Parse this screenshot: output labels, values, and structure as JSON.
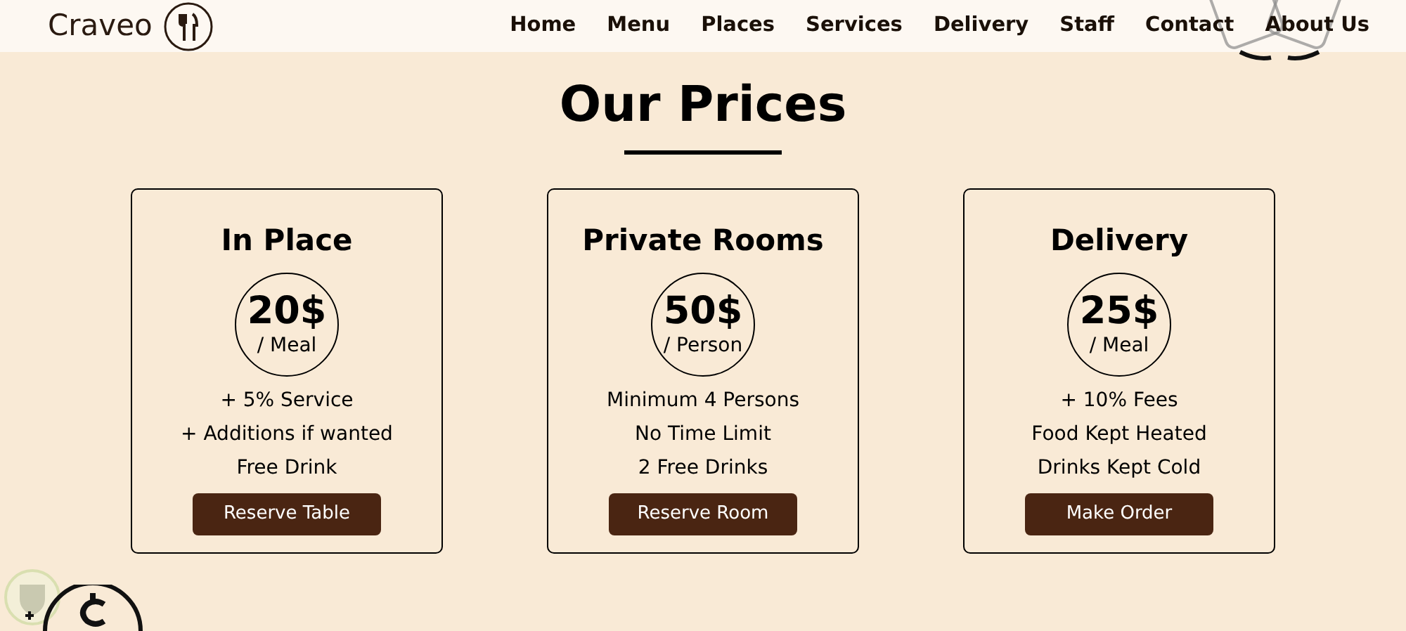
{
  "brand": "Craveo",
  "nav": [
    "Home",
    "Menu",
    "Places",
    "Services",
    "Delivery",
    "Staff",
    "Contact",
    "About Us"
  ],
  "title": "Our Prices",
  "plans": [
    {
      "name": "In Place",
      "price": "20$",
      "unit": "/ Meal",
      "features": [
        "+ 5% Service",
        "+ Additions if wanted",
        "Free Drink"
      ],
      "button": "Reserve Table"
    },
    {
      "name": "Private Rooms",
      "price": "50$",
      "unit": "/ Person",
      "features": [
        "Minimum 4 Persons",
        "No Time Limit",
        "2 Free Drinks"
      ],
      "button": "Reserve Room"
    },
    {
      "name": "Delivery",
      "price": "25$",
      "unit": "/ Meal",
      "features": [
        "+ 10% Fees",
        "Food Kept Heated",
        "Drinks Kept Cold"
      ],
      "button": "Make Order"
    }
  ]
}
